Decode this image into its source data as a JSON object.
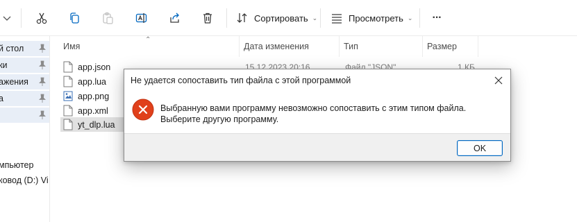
{
  "toolbar": {
    "sort_label": "Сортировать",
    "view_label": "Просмотреть",
    "more_label": "···"
  },
  "nav": {
    "items": [
      {
        "label": "й стол",
        "pinned": true
      },
      {
        "label": "ки",
        "pinned": true
      },
      {
        "label": "ажения",
        "pinned": true
      },
      {
        "label": "а",
        "pinned": true
      },
      {
        "label": "",
        "pinned": true
      },
      {
        "label": "мпьютер",
        "pinned": false
      },
      {
        "label": "ковод (D:) Vi",
        "pinned": false
      }
    ]
  },
  "columns": {
    "name": "Имя",
    "date": "Дата изменения",
    "type": "Тип",
    "size": "Размер"
  },
  "files": [
    {
      "name": "app.json",
      "date": "15.12.2023 20:16",
      "type": "Файл \"JSON\"",
      "size": "1 КБ",
      "icon": "file-icon"
    },
    {
      "name": "app.lua",
      "icon": "file-icon"
    },
    {
      "name": "app.png",
      "icon": "image-file-icon"
    },
    {
      "name": "app.xml",
      "icon": "file-icon"
    },
    {
      "name": "yt_dlp.lua",
      "icon": "file-icon"
    }
  ],
  "dialog": {
    "title": "Не удается сопоставить тип файла с этой программой",
    "message": "Выбранную вами программу невозможно сопоставить с этим типом файла. Выберите другую программу.",
    "ok_label": "OK",
    "icon": "error-icon",
    "icon_color": "#d83b01"
  },
  "colors": {
    "accent": "#0067c0",
    "error": "#e0401b",
    "selection": "#e1e1e1"
  }
}
